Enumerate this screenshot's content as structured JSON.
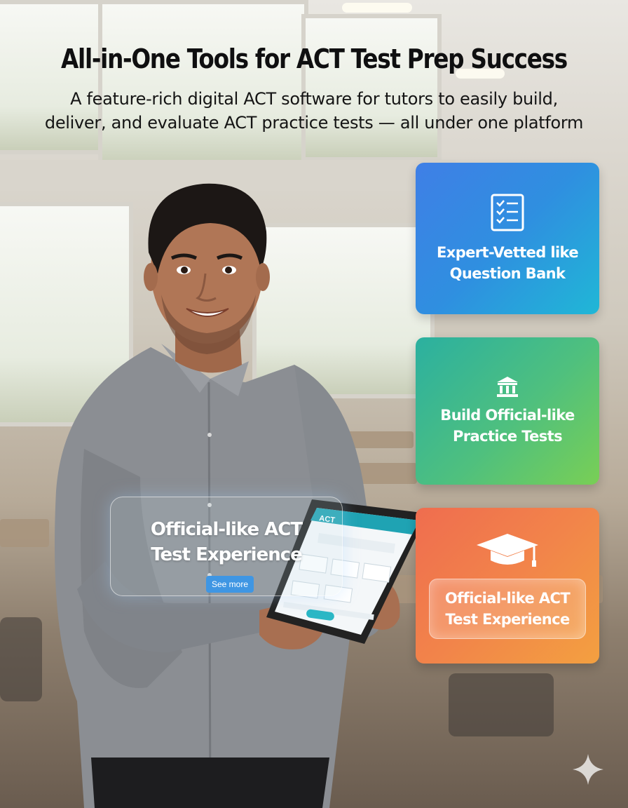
{
  "header": {
    "title": "All-in-One Tools for ACT Test Prep Success",
    "subtitle_line1": "A feature-rich digital ACT software for tutors to easily build,",
    "subtitle_line2": "deliver, and evaluate ACT practice tests — all under one platform"
  },
  "cards": [
    {
      "icon": "checklist-icon",
      "line1": "Expert-Vetted like",
      "line2": "Question Bank",
      "color": "#2f8fe0"
    },
    {
      "icon": "building-icon",
      "line1": "Build Official-like",
      "line2": "Practice Tests",
      "color": "#4fc07e"
    },
    {
      "icon": "graduation-cap-icon",
      "line1": "Official-like ACT",
      "line2": "Test Experience",
      "color": "#f2844a"
    }
  ],
  "overlay": {
    "line1": "Official-like ACT",
    "line2": "Test Experience",
    "button_label": "See more"
  },
  "tablet": {
    "logo": "ACT"
  },
  "colors": {
    "accent_blue": "#3f96e3",
    "tablet_header": "#1fa3b3"
  }
}
